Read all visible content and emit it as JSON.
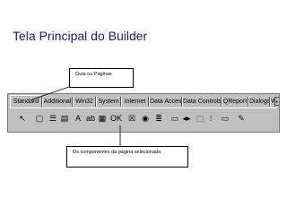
{
  "slide": {
    "title": "Tela Principal do Builder",
    "callout_tabs": "Guia ou Páginas",
    "callout_components": "Os componentes da página selecionada"
  },
  "palette": {
    "tabs": [
      "Standard",
      "Additional",
      "Win32",
      "System",
      "Internet",
      "Data Access",
      "Data Controls",
      "QReport",
      "Dialogs",
      "Wi"
    ],
    "active_tab": "Standard",
    "tools": [
      {
        "icon": "pointer-arrow-icon",
        "glyph": "↖"
      },
      {
        "icon": "frame-icon",
        "glyph": "▢"
      },
      {
        "icon": "main-menu-icon",
        "glyph": "☰"
      },
      {
        "icon": "popup-menu-icon",
        "glyph": "▤"
      },
      {
        "icon": "label-icon",
        "glyph": "A"
      },
      {
        "icon": "edit-icon",
        "glyph": "ab"
      },
      {
        "icon": "memo-icon",
        "glyph": "▦"
      },
      {
        "icon": "button-icon",
        "glyph": "OK"
      },
      {
        "icon": "checkbox-icon",
        "glyph": "☒"
      },
      {
        "icon": "radio-button-icon",
        "glyph": "◉"
      },
      {
        "icon": "listbox-icon",
        "glyph": "≣"
      },
      {
        "icon": "combobox-icon",
        "glyph": "▭"
      },
      {
        "icon": "scrollbar-icon",
        "glyph": "◂▸"
      },
      {
        "icon": "groupbox-icon",
        "glyph": "⬚"
      },
      {
        "icon": "radio-group-icon",
        "glyph": "⁝"
      },
      {
        "icon": "panel-icon",
        "glyph": "▭"
      },
      {
        "icon": "action-list-icon",
        "glyph": "✎"
      }
    ]
  },
  "colors": {
    "title": "#1a1a80",
    "palette_background": "#c0c0c0"
  }
}
